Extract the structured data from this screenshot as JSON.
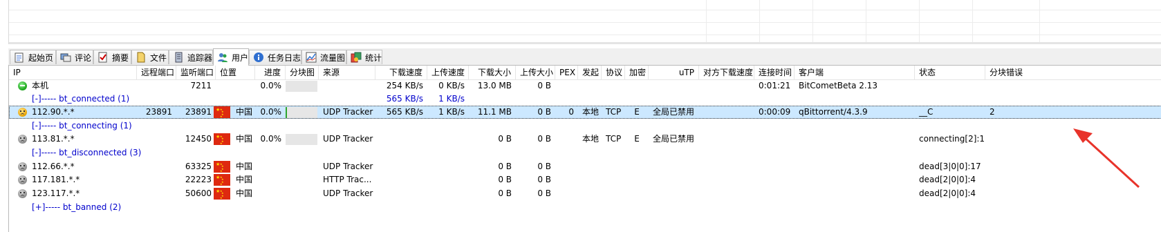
{
  "tabs": [
    {
      "label": "起始页",
      "icon": "home-page-icon"
    },
    {
      "label": "评论",
      "icon": "comment-icon"
    },
    {
      "label": "摘要",
      "icon": "summary-icon"
    },
    {
      "label": "文件",
      "icon": "file-icon"
    },
    {
      "label": "追踪器",
      "icon": "tracker-icon"
    },
    {
      "label": "用户",
      "icon": "users-icon",
      "active": true
    },
    {
      "label": "任务日志",
      "icon": "info-icon"
    },
    {
      "label": "流量图",
      "icon": "chart-icon"
    },
    {
      "label": "统计",
      "icon": "stats-icon"
    }
  ],
  "columns": {
    "ip": "IP",
    "remote_port": "远程端口",
    "listen_port": "监听端口",
    "location": "位置",
    "progress": "进度",
    "piece_map": "分块图",
    "source": "来源",
    "down_speed": "下载速度",
    "up_speed": "上传速度",
    "downloaded": "下载大小",
    "uploaded": "上传大小",
    "pex": "PEX",
    "initiator": "发起",
    "protocol": "协议",
    "encryption": "加密",
    "utp": "uTP",
    "peer_down_speed": "对方下载速度",
    "conn_time": "连接时间",
    "client": "客户端",
    "status": "状态",
    "piece_errors": "分块错误"
  },
  "self_row": {
    "ip": "本机",
    "listen_port": "7211",
    "progress": "0.0%",
    "down_speed": "254 KB/s",
    "up_speed": "0 KB/s",
    "downloaded": "13.0 MB",
    "uploaded": "0 B",
    "conn_time": "0:01:21",
    "client": "BitCometBeta 2.13"
  },
  "groups": {
    "connected": {
      "label": "[-]----- bt_connected (1)",
      "down_speed": "565 KB/s",
      "up_speed": "1 KB/s"
    },
    "connecting": {
      "label": "[-]----- bt_connecting (1)"
    },
    "disconnected": {
      "label": "[-]----- bt_disconnected (3)"
    },
    "banned": {
      "label": "[+]----- bt_banned (2)"
    }
  },
  "peers": [
    {
      "ip": "112.90.*.*",
      "remote_port": "23891",
      "listen_port": "23891",
      "country": "中国",
      "progress": "0.0%",
      "source": "UDP Tracker",
      "down_speed": "565 KB/s",
      "up_speed": "1 KB/s",
      "downloaded": "11.1 MB",
      "uploaded": "0 B",
      "pex": "0",
      "initiator": "本地",
      "protocol": "TCP",
      "encryption": "E",
      "utp": "全局已禁用",
      "conn_time": "0:00:09",
      "client": "qBittorrent/4.3.9",
      "status": "__C",
      "piece_errors": "2",
      "selected": true,
      "face": "orange"
    },
    {
      "ip": "113.81.*.*",
      "remote_port": "",
      "listen_port": "12450",
      "country": "中国",
      "progress": "0.0%",
      "source": "UDP Tracker",
      "down_speed": "",
      "up_speed": "",
      "downloaded": "0 B",
      "uploaded": "0 B",
      "pex": "",
      "initiator": "本地",
      "protocol": "TCP",
      "encryption": "E",
      "utp": "全局已禁用",
      "conn_time": "",
      "client": "",
      "status": "connecting[2]:1",
      "piece_errors": "",
      "face": "gray"
    },
    {
      "ip": "112.66.*.*",
      "remote_port": "",
      "listen_port": "63325",
      "country": "中国",
      "progress": "",
      "source": "UDP Tracker",
      "down_speed": "",
      "up_speed": "",
      "downloaded": "0 B",
      "uploaded": "0 B",
      "pex": "",
      "initiator": "",
      "protocol": "",
      "encryption": "",
      "utp": "",
      "conn_time": "",
      "client": "",
      "status": "dead[3|0|0]:17",
      "piece_errors": "",
      "face": "gray"
    },
    {
      "ip": "117.181.*.*",
      "remote_port": "",
      "listen_port": "22223",
      "country": "中国",
      "progress": "",
      "source": "HTTP Trac...",
      "down_speed": "",
      "up_speed": "",
      "downloaded": "0 B",
      "uploaded": "0 B",
      "pex": "",
      "initiator": "",
      "protocol": "",
      "encryption": "",
      "utp": "",
      "conn_time": "",
      "client": "",
      "status": "dead[2|0|0]:4",
      "piece_errors": "",
      "face": "gray"
    },
    {
      "ip": "123.117.*.*",
      "remote_port": "",
      "listen_port": "50600",
      "country": "中国",
      "progress": "",
      "source": "UDP Tracker",
      "down_speed": "",
      "up_speed": "",
      "downloaded": "0 B",
      "uploaded": "0 B",
      "pex": "",
      "initiator": "",
      "protocol": "",
      "encryption": "",
      "utp": "",
      "conn_time": "",
      "client": "",
      "status": "dead[2|0|0]:4",
      "piece_errors": "",
      "face": "gray"
    }
  ],
  "annotation": {
    "color": "#e8332a"
  }
}
